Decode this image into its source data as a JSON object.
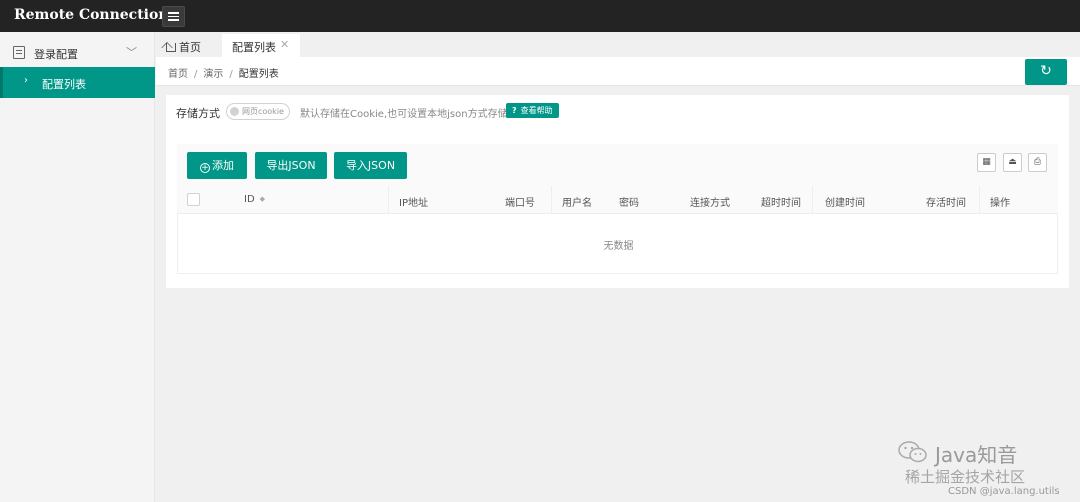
{
  "app": {
    "title": "Remote Connection"
  },
  "sidebar": {
    "group": {
      "label": "登录配置",
      "icon": "form-icon"
    },
    "items": [
      {
        "label": "配置列表",
        "active": true
      }
    ]
  },
  "tabs": [
    {
      "label": "首页",
      "icon": "home-icon"
    },
    {
      "label": "配置列表",
      "active": true
    }
  ],
  "breadcrumb": {
    "items": [
      "首页",
      "演示"
    ],
    "current": "配置列表",
    "separator": "/"
  },
  "storage": {
    "label": "存储方式",
    "toggle_text": "网页cookie",
    "hint": "默认存储在Cookie,也可设置本地json方式存储",
    "help_label": "查看帮助"
  },
  "toolbar": {
    "add_label": "添加",
    "export_label": "导出JSON",
    "import_label": "导入JSON"
  },
  "table": {
    "columns": [
      "ID",
      "IP地址",
      "端口号",
      "用户名",
      "密码",
      "连接方式",
      "超时时间",
      "创建时间",
      "存活时间",
      "操作"
    ],
    "empty_text": "无数据"
  },
  "watermark": {
    "title": "Java知音",
    "subtitle": "稀土掘金技术社区",
    "credit": "CSDN @java.lang.utils"
  },
  "colors": {
    "accent": "#009688",
    "topbar": "#232323"
  }
}
